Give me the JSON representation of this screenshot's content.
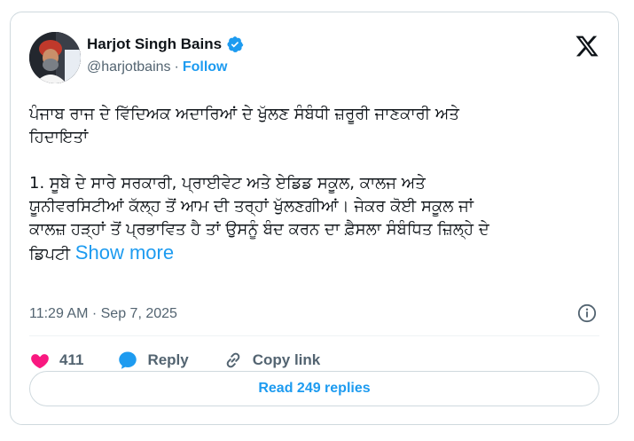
{
  "author": {
    "name": "Harjot Singh Bains",
    "handle": "@harjotbains",
    "separator": "·",
    "follow_label": "Follow"
  },
  "tweet": {
    "text": "ਪੰਜਾਬ ਰਾਜ ਦੇ ਵਿੱਦਿਅਕ ਅਦਾਰਿਆਂ ਦੇ ਖੁੱਲਣ ਸੰਬੰਧੀ ਜ਼ਰੂਰੀ ਜਾਣਕਾਰੀ ਅਤੇ\nਹਿਦਾਇਤਾਂ\n\n1. ਸੂਬੇ ਦੇ ਸਾਰੇ ਸਰਕਾਰੀ, ਪ੍ਰਾਈਵੇਟ ਅਤੇ ਏਡਿਡ ਸਕੂਲ, ਕਾਲਜ ਅਤੇ\nਯੂਨੀਵਰਸਿਟੀਆਂ ਕੱਲ੍ਹ ਤੋਂ ਆਮ ਦੀ ਤਰ੍ਹਾਂ ਖੁੱਲਣਗੀਆਂ। ਜੇਕਰ ਕੋਈ ਸਕੂਲ ਜਾਂ\nਕਾਲਜ਼ ਹੜ੍ਹਾਂ ਤੋਂ ਪ੍ਰਭਾਵਿਤ ਹੈ ਤਾਂ ਉਸਨੂੰ ਬੰਦ ਕਰਨ ਦਾ ਫ਼ੈਸਲਾ ਸੰਬੰਧਿਤ ਜ਼ਿਲ੍ਹੇ ਦੇ\nਡਿਪਟੀ ",
    "show_more_label": "Show more",
    "timestamp": "11:29 AM · Sep 7, 2025"
  },
  "actions": {
    "likes_count": "411",
    "reply_label": "Reply",
    "copy_link_label": "Copy link"
  },
  "read_replies_label": "Read 249 replies",
  "colors": {
    "accent": "#1d9bf0",
    "like": "#f91880",
    "text": "#0f1419",
    "muted": "#536471",
    "border": "#cfd9de"
  },
  "icons": {
    "verified": "verified-badge-icon",
    "platform": "x-logo-icon",
    "info": "info-icon",
    "like": "heart-icon",
    "reply": "speech-bubble-icon",
    "copy_link": "link-icon"
  }
}
